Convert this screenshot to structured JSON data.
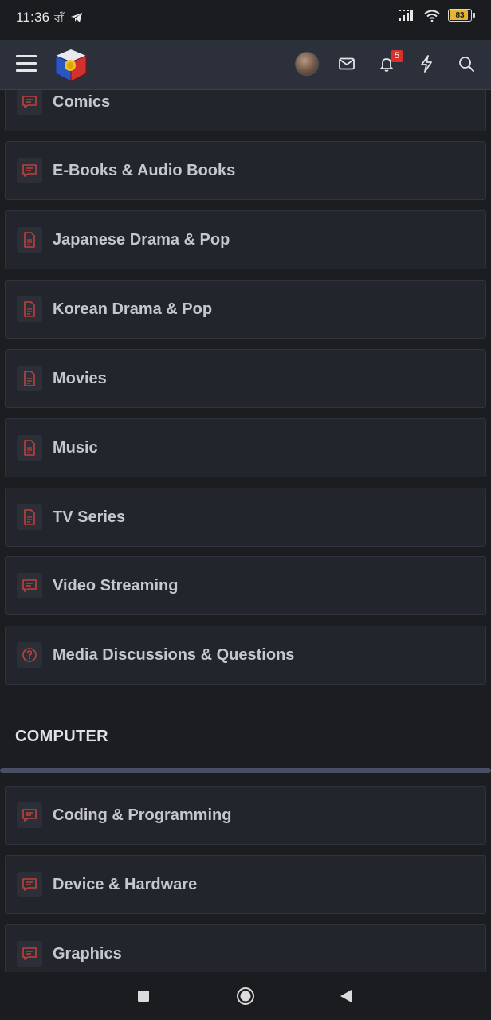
{
  "status": {
    "time": "11:36",
    "extra": "বাঁ",
    "battery": "83"
  },
  "nav": {
    "notification_count": "5"
  },
  "forums_group_a": [
    {
      "title": "Comics",
      "icon": "comment-icon"
    },
    {
      "title": "E-Books & Audio Books",
      "icon": "comment-icon"
    },
    {
      "title": "Japanese Drama & Pop",
      "icon": "document-icon"
    },
    {
      "title": "Korean Drama & Pop",
      "icon": "document-icon"
    },
    {
      "title": "Movies",
      "icon": "document-icon"
    },
    {
      "title": "Music",
      "icon": "document-icon"
    },
    {
      "title": "TV Series",
      "icon": "document-icon"
    },
    {
      "title": "Video Streaming",
      "icon": "comment-icon"
    },
    {
      "title": "Media Discussions & Questions",
      "icon": "question-icon"
    }
  ],
  "category": {
    "title": "COMPUTER"
  },
  "forums_group_b": [
    {
      "title": "Coding & Programming",
      "icon": "comment-icon"
    },
    {
      "title": "Device & Hardware",
      "icon": "comment-icon"
    },
    {
      "title": "Graphics",
      "icon": "comment-icon"
    }
  ],
  "colors": {
    "accent_icon": "#c0413c",
    "card_bg": "#23252c",
    "page_bg": "#1b1d21"
  }
}
